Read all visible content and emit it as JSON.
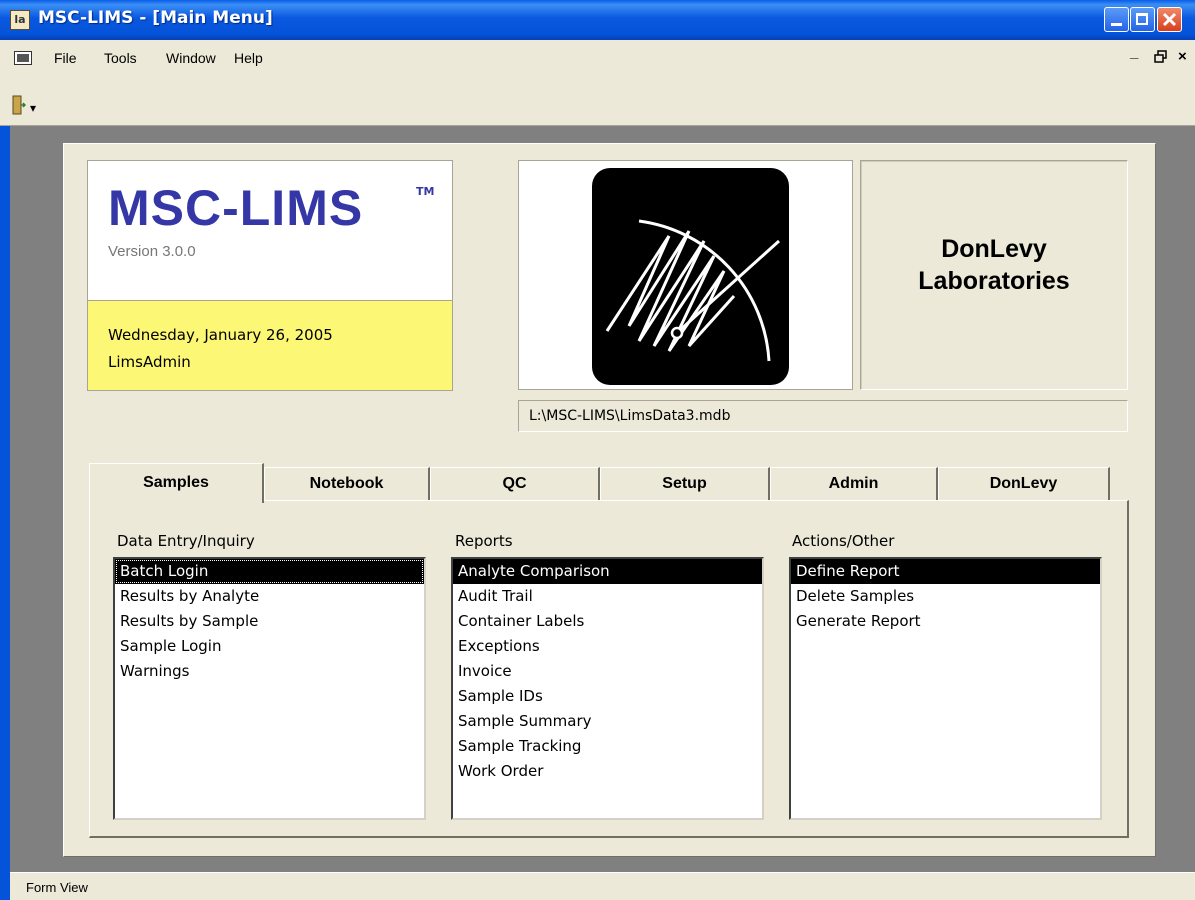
{
  "window": {
    "title": "MSC-LIMS - [Main Menu]",
    "app_icon_text": "la"
  },
  "menu": {
    "items": [
      "File",
      "Tools",
      "Window",
      "Help"
    ],
    "mdi_controls": [
      "_",
      "ĸ",
      "×"
    ]
  },
  "toolbar": {
    "dropdown_glyph": "▾"
  },
  "logo": {
    "product": "MSC-LIMS",
    "tm": "TM",
    "version": "Version 3.0.0"
  },
  "session": {
    "date": "Wednesday, January 26, 2005",
    "user": "LimsAdmin"
  },
  "company": {
    "line1": "DonLevy",
    "line2": "Laboratories"
  },
  "database_path": "L:\\MSC-LIMS\\LimsData3.mdb",
  "tabs": [
    {
      "label": "Samples",
      "active": true
    },
    {
      "label": "Notebook",
      "active": false
    },
    {
      "label": "QC",
      "active": false
    },
    {
      "label": "Setup",
      "active": false
    },
    {
      "label": "Admin",
      "active": false
    },
    {
      "label": "DonLevy",
      "active": false
    }
  ],
  "groups": {
    "data_entry": {
      "label": "Data Entry/Inquiry",
      "items": [
        "Batch Login",
        "Results by Analyte",
        "Results by Sample",
        "Sample Login",
        "Warnings"
      ],
      "selected": "Batch Login"
    },
    "reports": {
      "label": "Reports",
      "items": [
        "Analyte Comparison",
        "Audit Trail",
        "Container Labels",
        "Exceptions",
        "Invoice",
        "Sample IDs",
        "Sample Summary",
        "Sample Tracking",
        "Work Order"
      ],
      "selected": "Analyte Comparison"
    },
    "actions": {
      "label": "Actions/Other",
      "items": [
        "Define Report",
        "Delete Samples",
        "Generate Report"
      ],
      "selected": "Define Report"
    }
  },
  "status": {
    "text": "Form View"
  },
  "colors": {
    "titlebar": "#0453d8",
    "logo_blue": "#3537a6",
    "info_yellow": "#fcf774",
    "form_bg": "#ece9d8",
    "mdi_bg": "#808080"
  }
}
